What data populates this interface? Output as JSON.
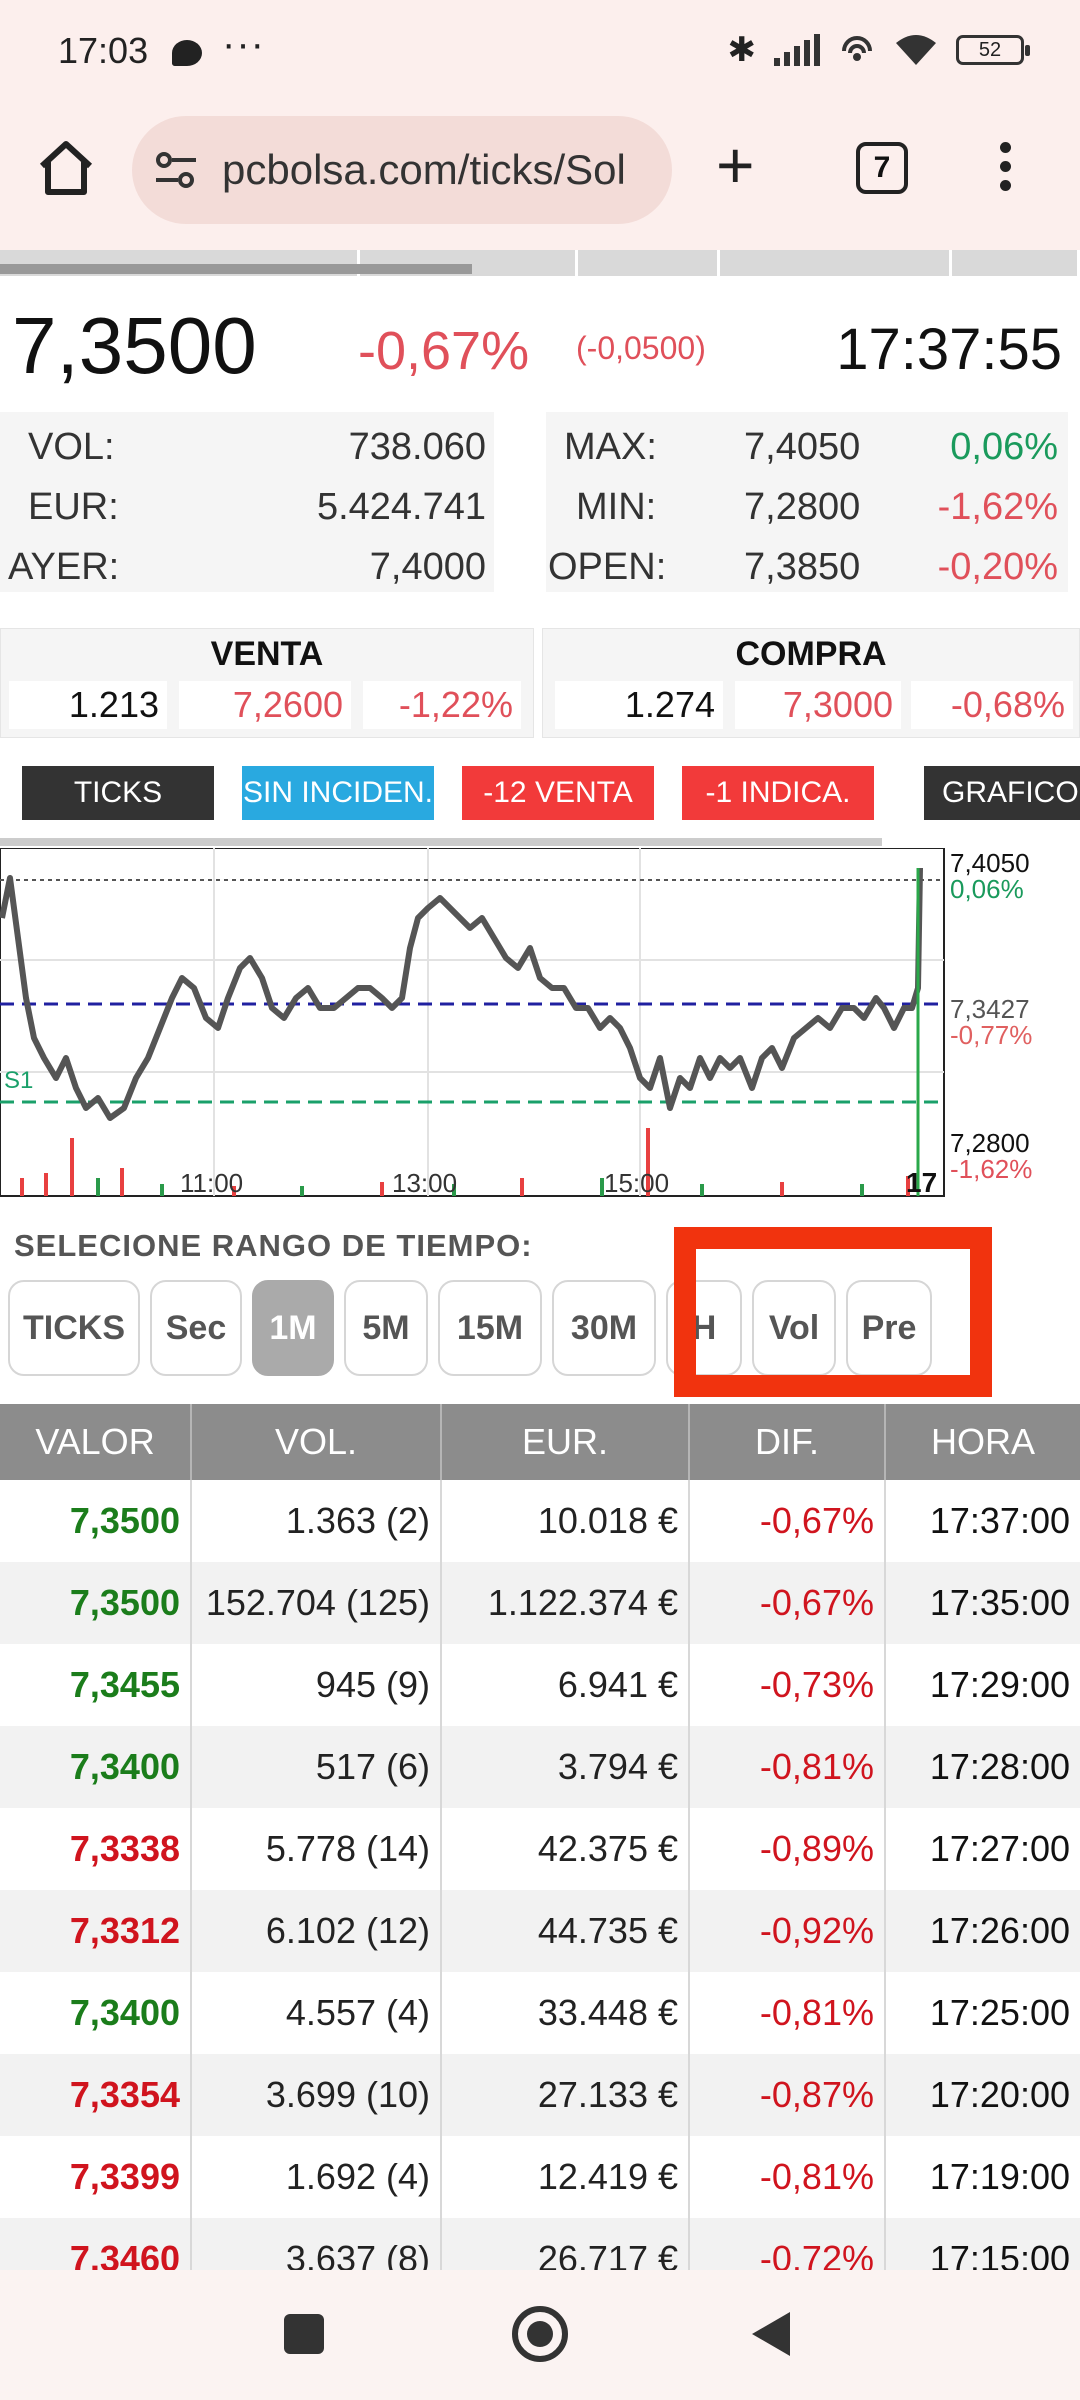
{
  "status_bar": {
    "time": "17:03",
    "dots": "···",
    "battery": "52"
  },
  "browser": {
    "url": "pcbolsa.com/ticks/Sol",
    "tab_count": "7"
  },
  "quote_header": {
    "price": "7,3500",
    "change_pct": "-0,67%",
    "change_abs": "(-0,0500)",
    "time": "17:37:55"
  },
  "stats_left": [
    {
      "label": "VOL:",
      "value": "738.060"
    },
    {
      "label": "EUR:",
      "value": "5.424.741"
    },
    {
      "label": "AYER:",
      "value": "7,4000"
    }
  ],
  "stats_right": [
    {
      "label": "MAX:",
      "value": "7,4050",
      "pct": "0,06%"
    },
    {
      "label": "MIN:",
      "value": "7,2800",
      "pct": "-1,62%"
    },
    {
      "label": "OPEN:",
      "value": "7,3850",
      "pct": "-0,20%"
    }
  ],
  "venta": {
    "title": "VENTA",
    "qty": "1.213",
    "price": "7,2600",
    "pct": "-1,22%"
  },
  "compra": {
    "title": "COMPRA",
    "qty": "1.274",
    "price": "7,3000",
    "pct": "-0,68%"
  },
  "action_buttons": [
    "TICKS",
    "SIN INCIDEN.",
    "-12 VENTA",
    "-1 INDICA.",
    "GRAFICO I"
  ],
  "colors": {
    "dark": "#333333",
    "blue": "#29a9e0",
    "red": "#f23a3a",
    "highlight": "#f1330e"
  },
  "chart_labels": {
    "max": "7,4050",
    "max_pct": "0,06%",
    "mid": "7,3427",
    "mid_pct": "-0,77%",
    "min": "7,2800",
    "min_pct": "-1,62%",
    "s1": "S1",
    "x_ticks": [
      "11:00",
      "13:00",
      "15:00",
      "17"
    ]
  },
  "range": {
    "title": "SELECIONE RANGO DE TIEMPO:",
    "buttons": [
      "TICKS",
      "Sec",
      "1M",
      "5M",
      "15M",
      "30M",
      "H",
      "Vol",
      "Pre"
    ],
    "active": "1M"
  },
  "table": {
    "headers": [
      "VALOR",
      "VOL.",
      "EUR.",
      "DIF.",
      "HORA"
    ],
    "rows": [
      {
        "valor": "7,3500",
        "vol": "1.363 (2)",
        "eur": "10.018 €",
        "dif": "-0,67%",
        "hora": "17:37:00",
        "dir": "up"
      },
      {
        "valor": "7,3500",
        "vol": "152.704 (125)",
        "eur": "1.122.374 €",
        "dif": "-0,67%",
        "hora": "17:35:00",
        "dir": "up"
      },
      {
        "valor": "7,3455",
        "vol": "945 (9)",
        "eur": "6.941 €",
        "dif": "-0,73%",
        "hora": "17:29:00",
        "dir": "up"
      },
      {
        "valor": "7,3400",
        "vol": "517 (6)",
        "eur": "3.794 €",
        "dif": "-0,81%",
        "hora": "17:28:00",
        "dir": "up"
      },
      {
        "valor": "7,3338",
        "vol": "5.778 (14)",
        "eur": "42.375 €",
        "dif": "-0,89%",
        "hora": "17:27:00",
        "dir": "dn"
      },
      {
        "valor": "7,3312",
        "vol": "6.102 (12)",
        "eur": "44.735 €",
        "dif": "-0,92%",
        "hora": "17:26:00",
        "dir": "dn"
      },
      {
        "valor": "7,3400",
        "vol": "4.557 (4)",
        "eur": "33.448 €",
        "dif": "-0,81%",
        "hora": "17:25:00",
        "dir": "up"
      },
      {
        "valor": "7,3354",
        "vol": "3.699 (10)",
        "eur": "27.133 €",
        "dif": "-0,87%",
        "hora": "17:20:00",
        "dir": "dn"
      },
      {
        "valor": "7,3399",
        "vol": "1.692 (4)",
        "eur": "12.419 €",
        "dif": "-0,81%",
        "hora": "17:19:00",
        "dir": "dn"
      },
      {
        "valor": "7,3460",
        "vol": "3.637 (8)",
        "eur": "26.717 €",
        "dif": "-0,72%",
        "hora": "17:15:00",
        "dir": "dn"
      }
    ]
  }
}
